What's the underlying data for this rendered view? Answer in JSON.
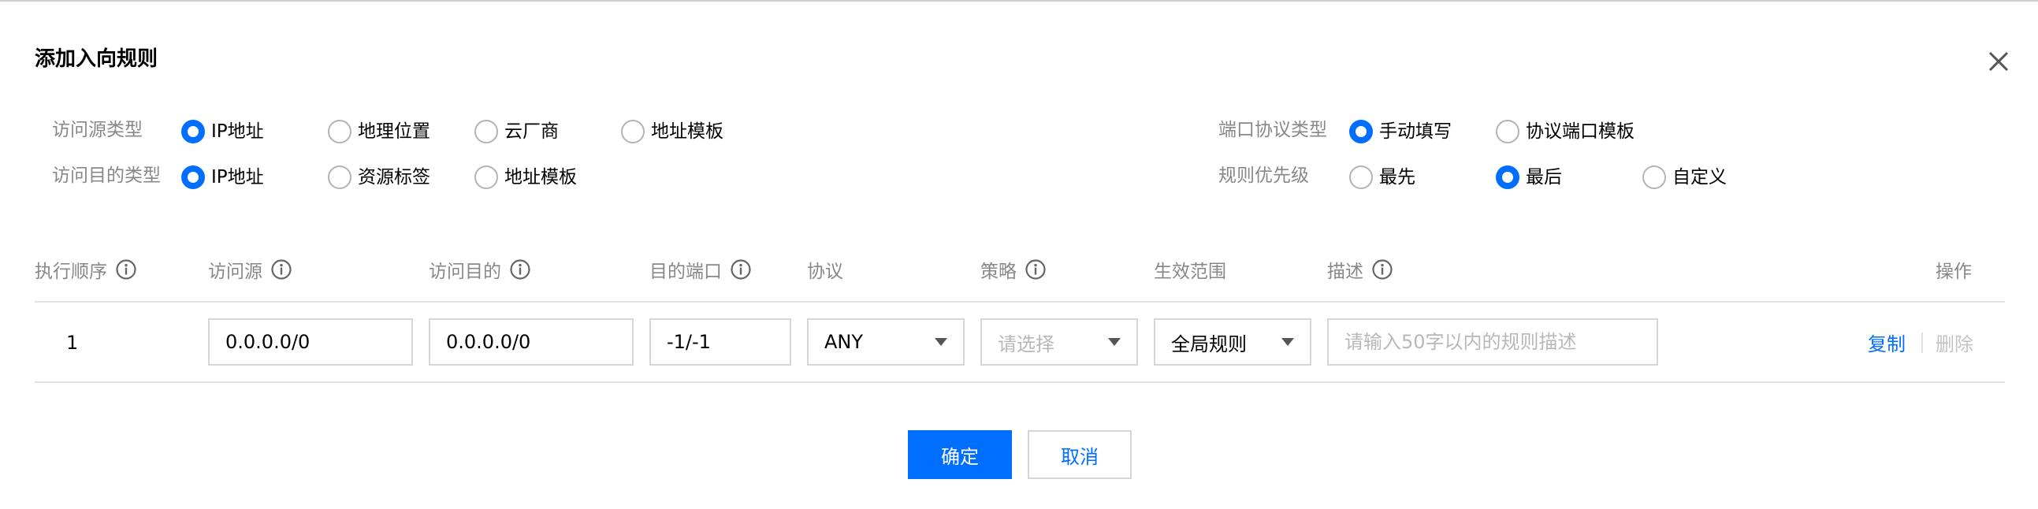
{
  "dialog": {
    "title": "添加入向规则"
  },
  "form": {
    "source_type": {
      "label": "访问源类型",
      "options": [
        "IP地址",
        "地理位置",
        "云厂商",
        "地址模板"
      ],
      "selected": "IP地址"
    },
    "dest_type": {
      "label": "访问目的类型",
      "options": [
        "IP地址",
        "资源标签",
        "地址模板"
      ],
      "selected": "IP地址"
    },
    "port_protocol_type": {
      "label": "端口协议类型",
      "options": [
        "手动填写",
        "协议端口模板"
      ],
      "selected": "手动填写"
    },
    "rule_priority": {
      "label": "规则优先级",
      "options": [
        "最先",
        "最后",
        "自定义"
      ],
      "selected": "最后"
    }
  },
  "table": {
    "headers": {
      "order": "执行顺序",
      "source": "访问源",
      "destination": "访问目的",
      "dest_port": "目的端口",
      "protocol": "协议",
      "policy": "策略",
      "scope": "生效范围",
      "description": "描述",
      "actions": "操作"
    },
    "row": {
      "order": "1",
      "source": "0.0.0.0/0",
      "destination": "0.0.0.0/0",
      "dest_port": "-1/-1",
      "protocol": "ANY",
      "policy_placeholder": "请选择",
      "scope": "全局规则",
      "description_placeholder": "请输入50字以内的规则描述",
      "copy_label": "复制",
      "delete_label": "删除"
    }
  },
  "footer": {
    "confirm_label": "确定",
    "cancel_label": "取消"
  },
  "colors": {
    "accent": "#006eff",
    "muted_text": "#888888",
    "border": "#d6d6d6",
    "disabled_text": "#c4c4c4"
  },
  "icons": {
    "close": "close-icon",
    "info": "info-icon",
    "dropdown": "chevron-down-icon"
  }
}
